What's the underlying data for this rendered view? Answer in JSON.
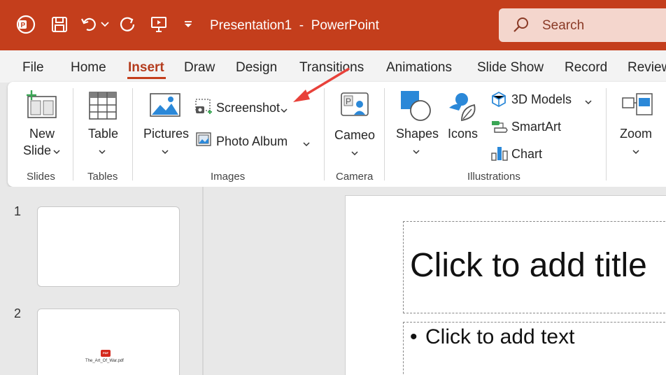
{
  "titlebar": {
    "doc_title": "Presentation1  -  PowerPoint",
    "search_placeholder": "Search",
    "bg_color": "#c43e1c"
  },
  "tabs": [
    {
      "label": "File"
    },
    {
      "label": "Home"
    },
    {
      "label": "Insert",
      "active": true
    },
    {
      "label": "Draw"
    },
    {
      "label": "Design"
    },
    {
      "label": "Transitions"
    },
    {
      "label": "Animations"
    },
    {
      "label": "Slide Show"
    },
    {
      "label": "Record"
    },
    {
      "label": "Review"
    }
  ],
  "ribbon": {
    "slides": {
      "new_slide_line1": "New",
      "new_slide_line2": "Slide",
      "group": "Slides"
    },
    "tables": {
      "table": "Table",
      "group": "Tables"
    },
    "images": {
      "pictures": "Pictures",
      "screenshot": "Screenshot",
      "photo_album": "Photo Album",
      "group": "Images"
    },
    "camera": {
      "cameo": "Cameo",
      "group": "Camera"
    },
    "illustrations": {
      "shapes": "Shapes",
      "icons": "Icons",
      "models3d": "3D Models",
      "smartart": "SmartArt",
      "chart": "Chart",
      "group": "Illustrations"
    },
    "links": {
      "zoom": "Zoom"
    }
  },
  "thumbnails": [
    {
      "number": "1"
    },
    {
      "number": "2",
      "file_label": "The_Art_Of_War.pdf",
      "badge": "PDF"
    }
  ],
  "slide": {
    "title_placeholder": "Click to add title",
    "body_placeholder": "Click to add text",
    "bullet": "•"
  },
  "accent": "#c43e1c",
  "annotation_arrow_color": "#e8413a"
}
